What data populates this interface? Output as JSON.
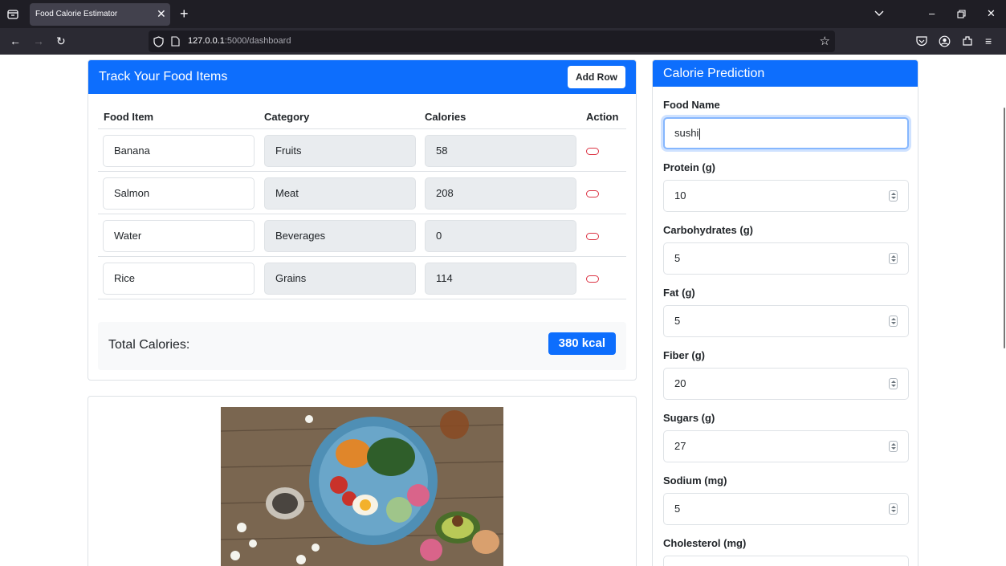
{
  "browser": {
    "tab_title": "Food Calorie Estimator",
    "url_host": "127.0.0.1",
    "url_path": ":5000/dashboard"
  },
  "tracker": {
    "title": "Track Your Food Items",
    "add_row_label": "Add Row",
    "columns": [
      "Food Item",
      "Category",
      "Calories",
      "Action"
    ],
    "rows": [
      {
        "food": "Banana",
        "category": "Fruits",
        "calories": "58"
      },
      {
        "food": "Salmon",
        "category": "Meat",
        "calories": "208"
      },
      {
        "food": "Water",
        "category": "Beverages",
        "calories": "0"
      },
      {
        "food": "Rice",
        "category": "Grains",
        "calories": "114"
      }
    ],
    "total_label": "Total Calories:",
    "total_value": "380 kcal"
  },
  "prediction": {
    "title": "Calorie Prediction",
    "fields": [
      {
        "label": "Food Name",
        "value": "sushi"
      },
      {
        "label": "Protein (g)",
        "value": "10"
      },
      {
        "label": "Carbohydrates (g)",
        "value": "5"
      },
      {
        "label": "Fat (g)",
        "value": "5"
      },
      {
        "label": "Fiber (g)",
        "value": "20"
      },
      {
        "label": "Sugars (g)",
        "value": "27"
      },
      {
        "label": "Sodium (mg)",
        "value": "5"
      },
      {
        "label": "Cholesterol (mg)",
        "value": ""
      }
    ]
  },
  "colors": {
    "primary": "#0d6efd",
    "danger": "#dc3545",
    "browser_dark": "#1f1e25"
  }
}
